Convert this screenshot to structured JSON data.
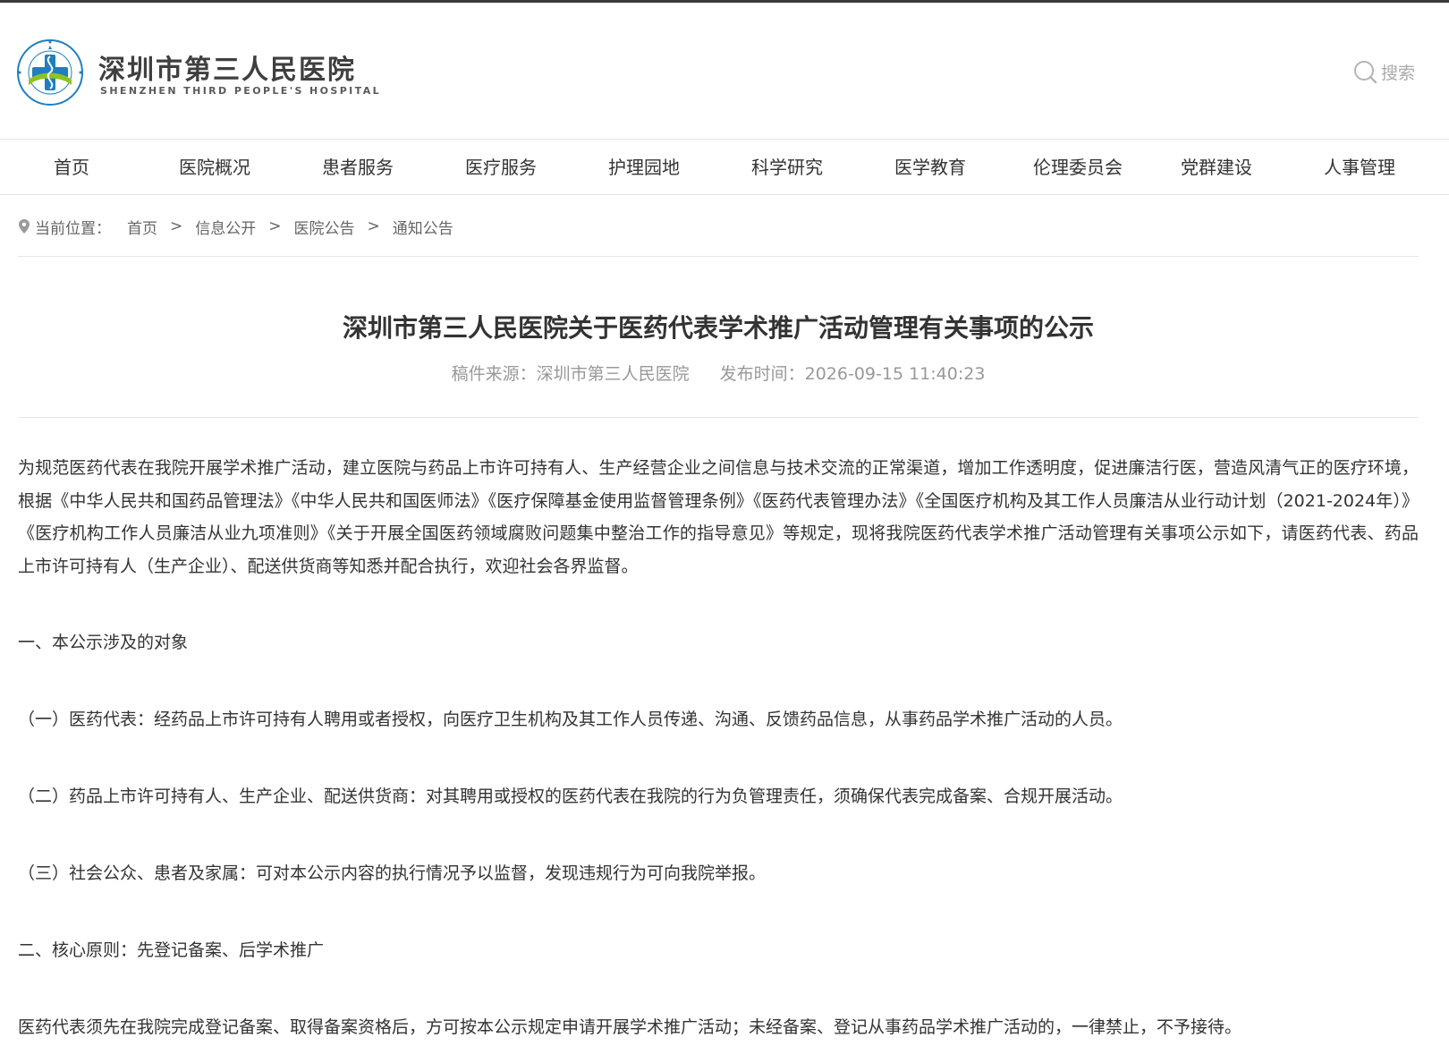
{
  "header": {
    "logo_cn": "深圳市第三人民医院",
    "logo_en": "SHENZHEN THIRD PEOPLE'S HOSPITAL",
    "emblem_ring_text": "深圳市第三人民医院 SHENZHEN THIRD PEOPLE'S HOSPITAL",
    "search_label": "搜索"
  },
  "nav": {
    "items": [
      "首页",
      "医院概况",
      "患者服务",
      "医疗服务",
      "护理园地",
      "科学研究",
      "医学教育",
      "伦理委员会",
      "党群建设",
      "人事管理"
    ]
  },
  "breadcrumb": {
    "label": "当前位置：",
    "items": [
      "首页",
      "信息公开",
      "医院公告",
      "通知公告"
    ],
    "separator": ">"
  },
  "article": {
    "title": "深圳市第三人民医院关于医药代表学术推广活动管理有关事项的公示",
    "source": "稿件来源：深圳市第三人民医院",
    "published": "发布时间：2026-09-15 11:40:23",
    "intro": "为规范医药代表在我院开展学术推广活动，建立医院与药品上市许可持有人、生产经营企业之间信息与技术交流的正常渠道，增加工作透明度，促进廉洁行医，营造风清气正的医疗环境，根据《中华人民共和国药品管理法》《中华人民共和国医师法》《医疗保障基金使用监督管理条例》《医药代表管理办法》《全国医疗机构及其工作人员廉洁从业行动计划（2021-2024年）》《医疗机构工作人员廉洁从业九项准则》《关于开展全国医药领域腐败问题集中整治工作的指导意见》等规定，现将我院医药代表学术推广活动管理有关事项公示如下，请医药代表、药品上市许可持有人（生产企业）、配送供货商等知悉并配合执行，欢迎社会各界监督。",
    "section1": "一、本公示涉及的对象",
    "item1": "（一）医药代表：经药品上市许可持有人聘用或者授权，向医疗卫生机构及其工作人员传递、沟通、反馈药品信息，从事药品学术推广活动的人员。",
    "item2": "（二）药品上市许可持有人、生产企业、配送供货商：对其聘用或授权的医药代表在我院的行为负管理责任，须确保代表完成备案、合规开展活动。",
    "item3": "（三）社会公众、患者及家属：可对本公示内容的执行情况予以监督，发现违规行为可向我院举报。",
    "section2": "二、核心原则：先登记备案、后学术推广",
    "principle": "医药代表须先在我院完成登记备案、取得备案资格后，方可按本公示规定申请开展学术推广活动；未经备案、登记从事药品学术推广活动的，一律禁止，不予接待。"
  },
  "colors": {
    "logo_blue": "#1f7fc0",
    "logo_green": "#8fc31f",
    "text": "#333333",
    "muted": "#999999"
  }
}
